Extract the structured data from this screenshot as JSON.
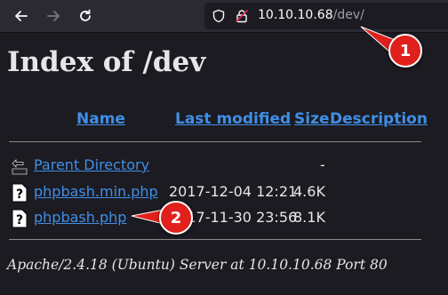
{
  "browser": {
    "url_host": "10.10.10.68",
    "url_path": "/dev/",
    "icons": [
      "back-arrow-icon",
      "forward-arrow-icon",
      "reload-icon",
      "shield-icon",
      "lock-icon"
    ]
  },
  "page": {
    "title": "Index of /dev",
    "columns": {
      "name": "Name",
      "last_modified": "Last modified",
      "size": "Size",
      "description": "Description"
    },
    "rows": [
      {
        "name": "Parent Directory",
        "modified": "",
        "size": "-",
        "icon": "back-folder-icon"
      },
      {
        "name": "phpbash.min.php",
        "modified": "2017-12-04 12:21",
        "size": "4.6K",
        "icon": "unknown-file-icon"
      },
      {
        "name": "phpbash.php",
        "modified": "2017-11-30 23:56",
        "size": "8.1K",
        "icon": "unknown-file-icon"
      }
    ],
    "footer": "Apache/2.4.18 (Ubuntu) Server at 10.10.10.68 Port 80"
  },
  "annotations": {
    "marker_1": "1",
    "marker_2": "2",
    "color": "#e0201c"
  }
}
